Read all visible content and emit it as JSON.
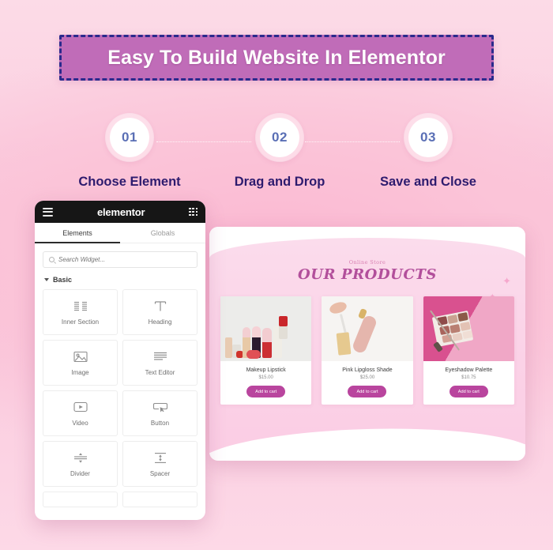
{
  "banner": {
    "title": "Easy To Build Website In Elementor",
    "fill_color": "#c06cb8",
    "border_color": "#2a2a8c"
  },
  "steps": [
    {
      "number": "01",
      "label": "Choose Element"
    },
    {
      "number": "02",
      "label": "Drag and Drop"
    },
    {
      "number": "03",
      "label": "Save and Close"
    }
  ],
  "panel": {
    "logo": "elementor",
    "menu_icon": "hamburger-icon",
    "apps_icon": "grid-icon",
    "tabs": [
      {
        "label": "Elements",
        "active": true
      },
      {
        "label": "Globals",
        "active": false
      }
    ],
    "search": {
      "placeholder": "Search Widget...",
      "value": "",
      "icon": "search-icon"
    },
    "section": {
      "label": "Basic",
      "expanded": true
    },
    "widgets": [
      {
        "label": "Inner Section",
        "icon": "columns-icon"
      },
      {
        "label": "Heading",
        "icon": "heading-t-icon"
      },
      {
        "label": "Image",
        "icon": "image-icon"
      },
      {
        "label": "Text Editor",
        "icon": "text-lines-icon"
      },
      {
        "label": "Video",
        "icon": "video-play-icon"
      },
      {
        "label": "Button",
        "icon": "button-cursor-icon"
      },
      {
        "label": "Divider",
        "icon": "divider-icon"
      },
      {
        "label": "Spacer",
        "icon": "spacer-icon"
      }
    ]
  },
  "product_page": {
    "eyebrow": "Online Store",
    "heading": "OUR PRODUCTS",
    "accent_color": "#b9459e",
    "products": [
      {
        "title": "Makeup Lipstick",
        "price": "$15.00",
        "button": "Add to cart"
      },
      {
        "title": "Pink Lipgloss Shade",
        "price": "$25.00",
        "button": "Add to cart"
      },
      {
        "title": "Eyeshadow Palette",
        "price": "$10.75",
        "button": "Add to cart"
      }
    ]
  }
}
